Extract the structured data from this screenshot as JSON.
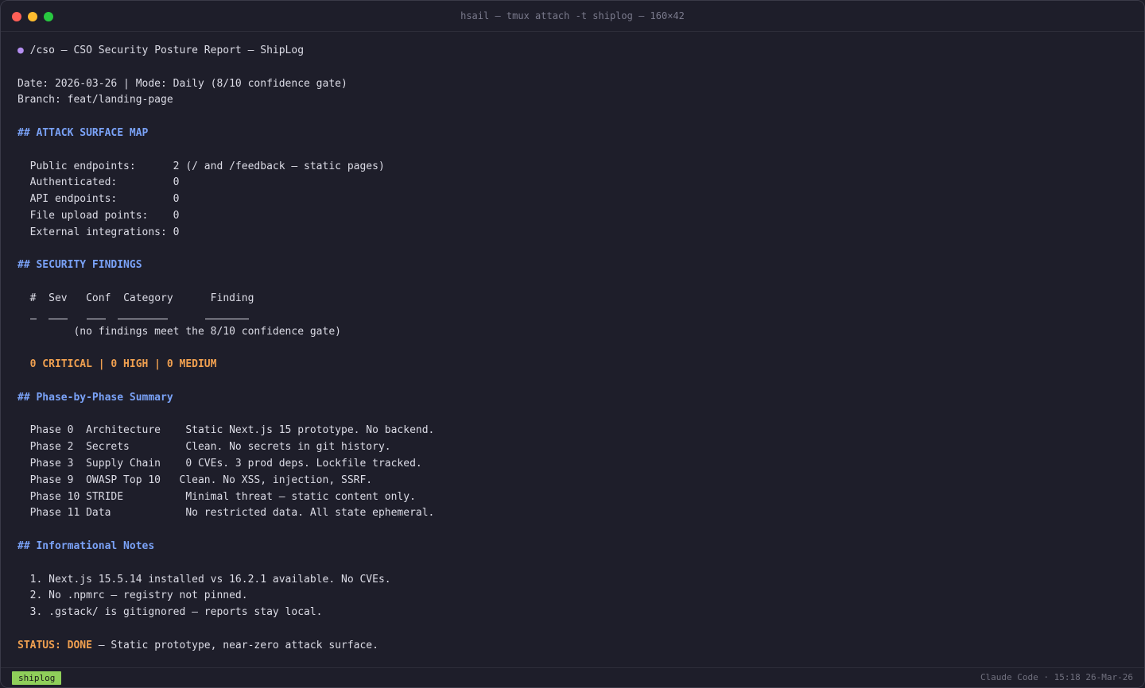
{
  "window": {
    "title": "hsail — tmux attach -t shiplog — 160×42"
  },
  "report": {
    "bullet": "●",
    "command_line": " /cso — CSO Security Posture Report — ShipLog",
    "date_line": "Date: 2026-03-26 | Mode: Daily (8/10 confidence gate)",
    "branch_line": "Branch: feat/landing-page",
    "attack_header": "## ATTACK SURFACE MAP",
    "attack_rows": [
      "  Public endpoints:      2 (/ and /feedback — static pages)",
      "  Authenticated:         0",
      "  API endpoints:         0",
      "  File upload points:    0",
      "  External integrations: 0"
    ],
    "findings_header": "## SECURITY FINDINGS",
    "findings_columns": {
      "num": "#",
      "sev": "Sev",
      "conf": "Conf",
      "category": "Category",
      "finding": "Finding"
    },
    "findings_empty": "         (no findings meet the 8/10 confidence gate)",
    "severity_summary": "  0 CRITICAL | 0 HIGH | 0 MEDIUM",
    "phase_header": "## Phase-by-Phase Summary",
    "phase_rows": [
      "  Phase 0  Architecture    Static Next.js 15 prototype. No backend.",
      "  Phase 2  Secrets         Clean. No secrets in git history.",
      "  Phase 3  Supply Chain    0 CVEs. 3 prod deps. Lockfile tracked.",
      "  Phase 9  OWASP Top 10   Clean. No XSS, injection, SSRF.",
      "  Phase 10 STRIDE          Minimal threat — static content only.",
      "  Phase 11 Data            No restricted data. All state ephemeral."
    ],
    "notes_header": "## Informational Notes",
    "notes": [
      "  1. Next.js 15.5.14 installed vs 16.2.1 available. No CVEs.",
      "  2. No .npmrc — registry not pinned.",
      "  3. .gstack/ is gitignored — reports stay local."
    ],
    "status_label": "STATUS: DONE",
    "status_text": " — Static prototype, near-zero attack surface."
  },
  "statusbar": {
    "session_tag": "shiplog",
    "right_text": "Claude Code · 15:18 26-Mar-26"
  },
  "colors": {
    "background": "#1e1e2a",
    "text": "#dcdce6",
    "heading": "#7aa2f7",
    "warning": "#f0a050",
    "session_tag": "#8fcf5a",
    "bullet": "#b48ef0"
  }
}
